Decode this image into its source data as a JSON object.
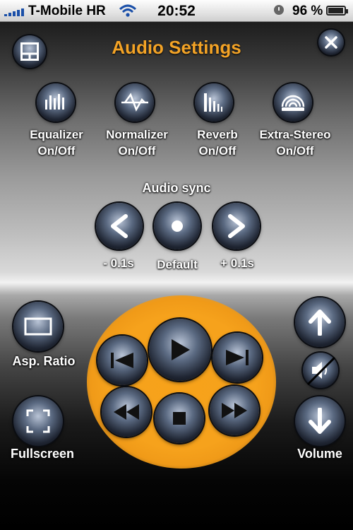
{
  "status_bar": {
    "carrier": "T-Mobile HR",
    "time": "20:52",
    "battery_percent": "96 %",
    "icons": [
      "signal-bars-icon",
      "wifi-icon",
      "clock-icon",
      "battery-icon"
    ]
  },
  "header": {
    "title": "Audio Settings",
    "title_color": "#f3a326",
    "left_icon": "layout-icon",
    "close_icon": "close-icon"
  },
  "audio_effects": [
    {
      "line1": "Equalizer",
      "line2": "On/Off",
      "icon": "equalizer-icon"
    },
    {
      "line1": "Normalizer",
      "line2": "On/Off",
      "icon": "normalizer-icon"
    },
    {
      "line1": "Reverb",
      "line2": "On/Off",
      "icon": "reverb-icon"
    },
    {
      "line1": "Extra-Stereo",
      "line2": "On/Off",
      "icon": "extra-stereo-icon"
    }
  ],
  "audio_sync": {
    "label": "Audio sync",
    "buttons": [
      {
        "label": "- 0.1s",
        "icon": "chevron-left-icon"
      },
      {
        "label": "Default",
        "icon": "dot-icon"
      },
      {
        "label": "+ 0.1s",
        "icon": "chevron-right-icon"
      }
    ]
  },
  "left_controls": {
    "aspect_ratio": "Asp. Ratio",
    "fullscreen": "Fullscreen"
  },
  "playback": {
    "pad_color": "#f6a21c",
    "buttons": [
      "skip-previous-icon",
      "play-icon",
      "skip-next-icon",
      "rewind-icon",
      "stop-icon",
      "fast-forward-icon"
    ]
  },
  "volume": {
    "label": "Volume",
    "icons": [
      "arrow-up-icon",
      "mute-icon",
      "arrow-down-icon"
    ]
  }
}
